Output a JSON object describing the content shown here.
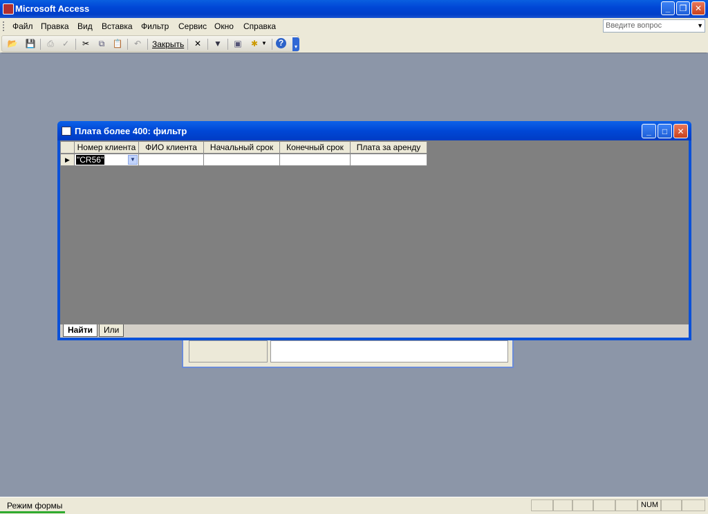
{
  "app": {
    "title": "Microsoft Access"
  },
  "menu": {
    "items": [
      "Файл",
      "Правка",
      "Вид",
      "Вставка",
      "Фильтр",
      "Сервис",
      "Окно",
      "Справка"
    ],
    "ask_placeholder": "Введите вопрос"
  },
  "toolbar": {
    "close_label": "Закрыть",
    "icons": [
      "open-icon",
      "save-icon",
      "print-icon",
      "spellcheck-icon",
      "cut-icon",
      "copy-icon",
      "paste-icon",
      "undo-icon",
      "clear-grid-icon",
      "apply-filter-icon",
      "new-window-icon",
      "new-object-icon",
      "help-icon"
    ]
  },
  "filter_window": {
    "title": "Плата более 400: фильтр",
    "columns": [
      "Номер клиента",
      "ФИО клиента",
      "Начальный срок",
      "Конечный срок",
      "Плата за аренду"
    ],
    "criteria": [
      "\"CR56\"",
      "",
      "",
      "",
      ""
    ],
    "tabs": [
      "Найти",
      "Или"
    ],
    "active_tab": "Найти"
  },
  "status": {
    "mode": "Режим формы",
    "num": "NUM"
  }
}
